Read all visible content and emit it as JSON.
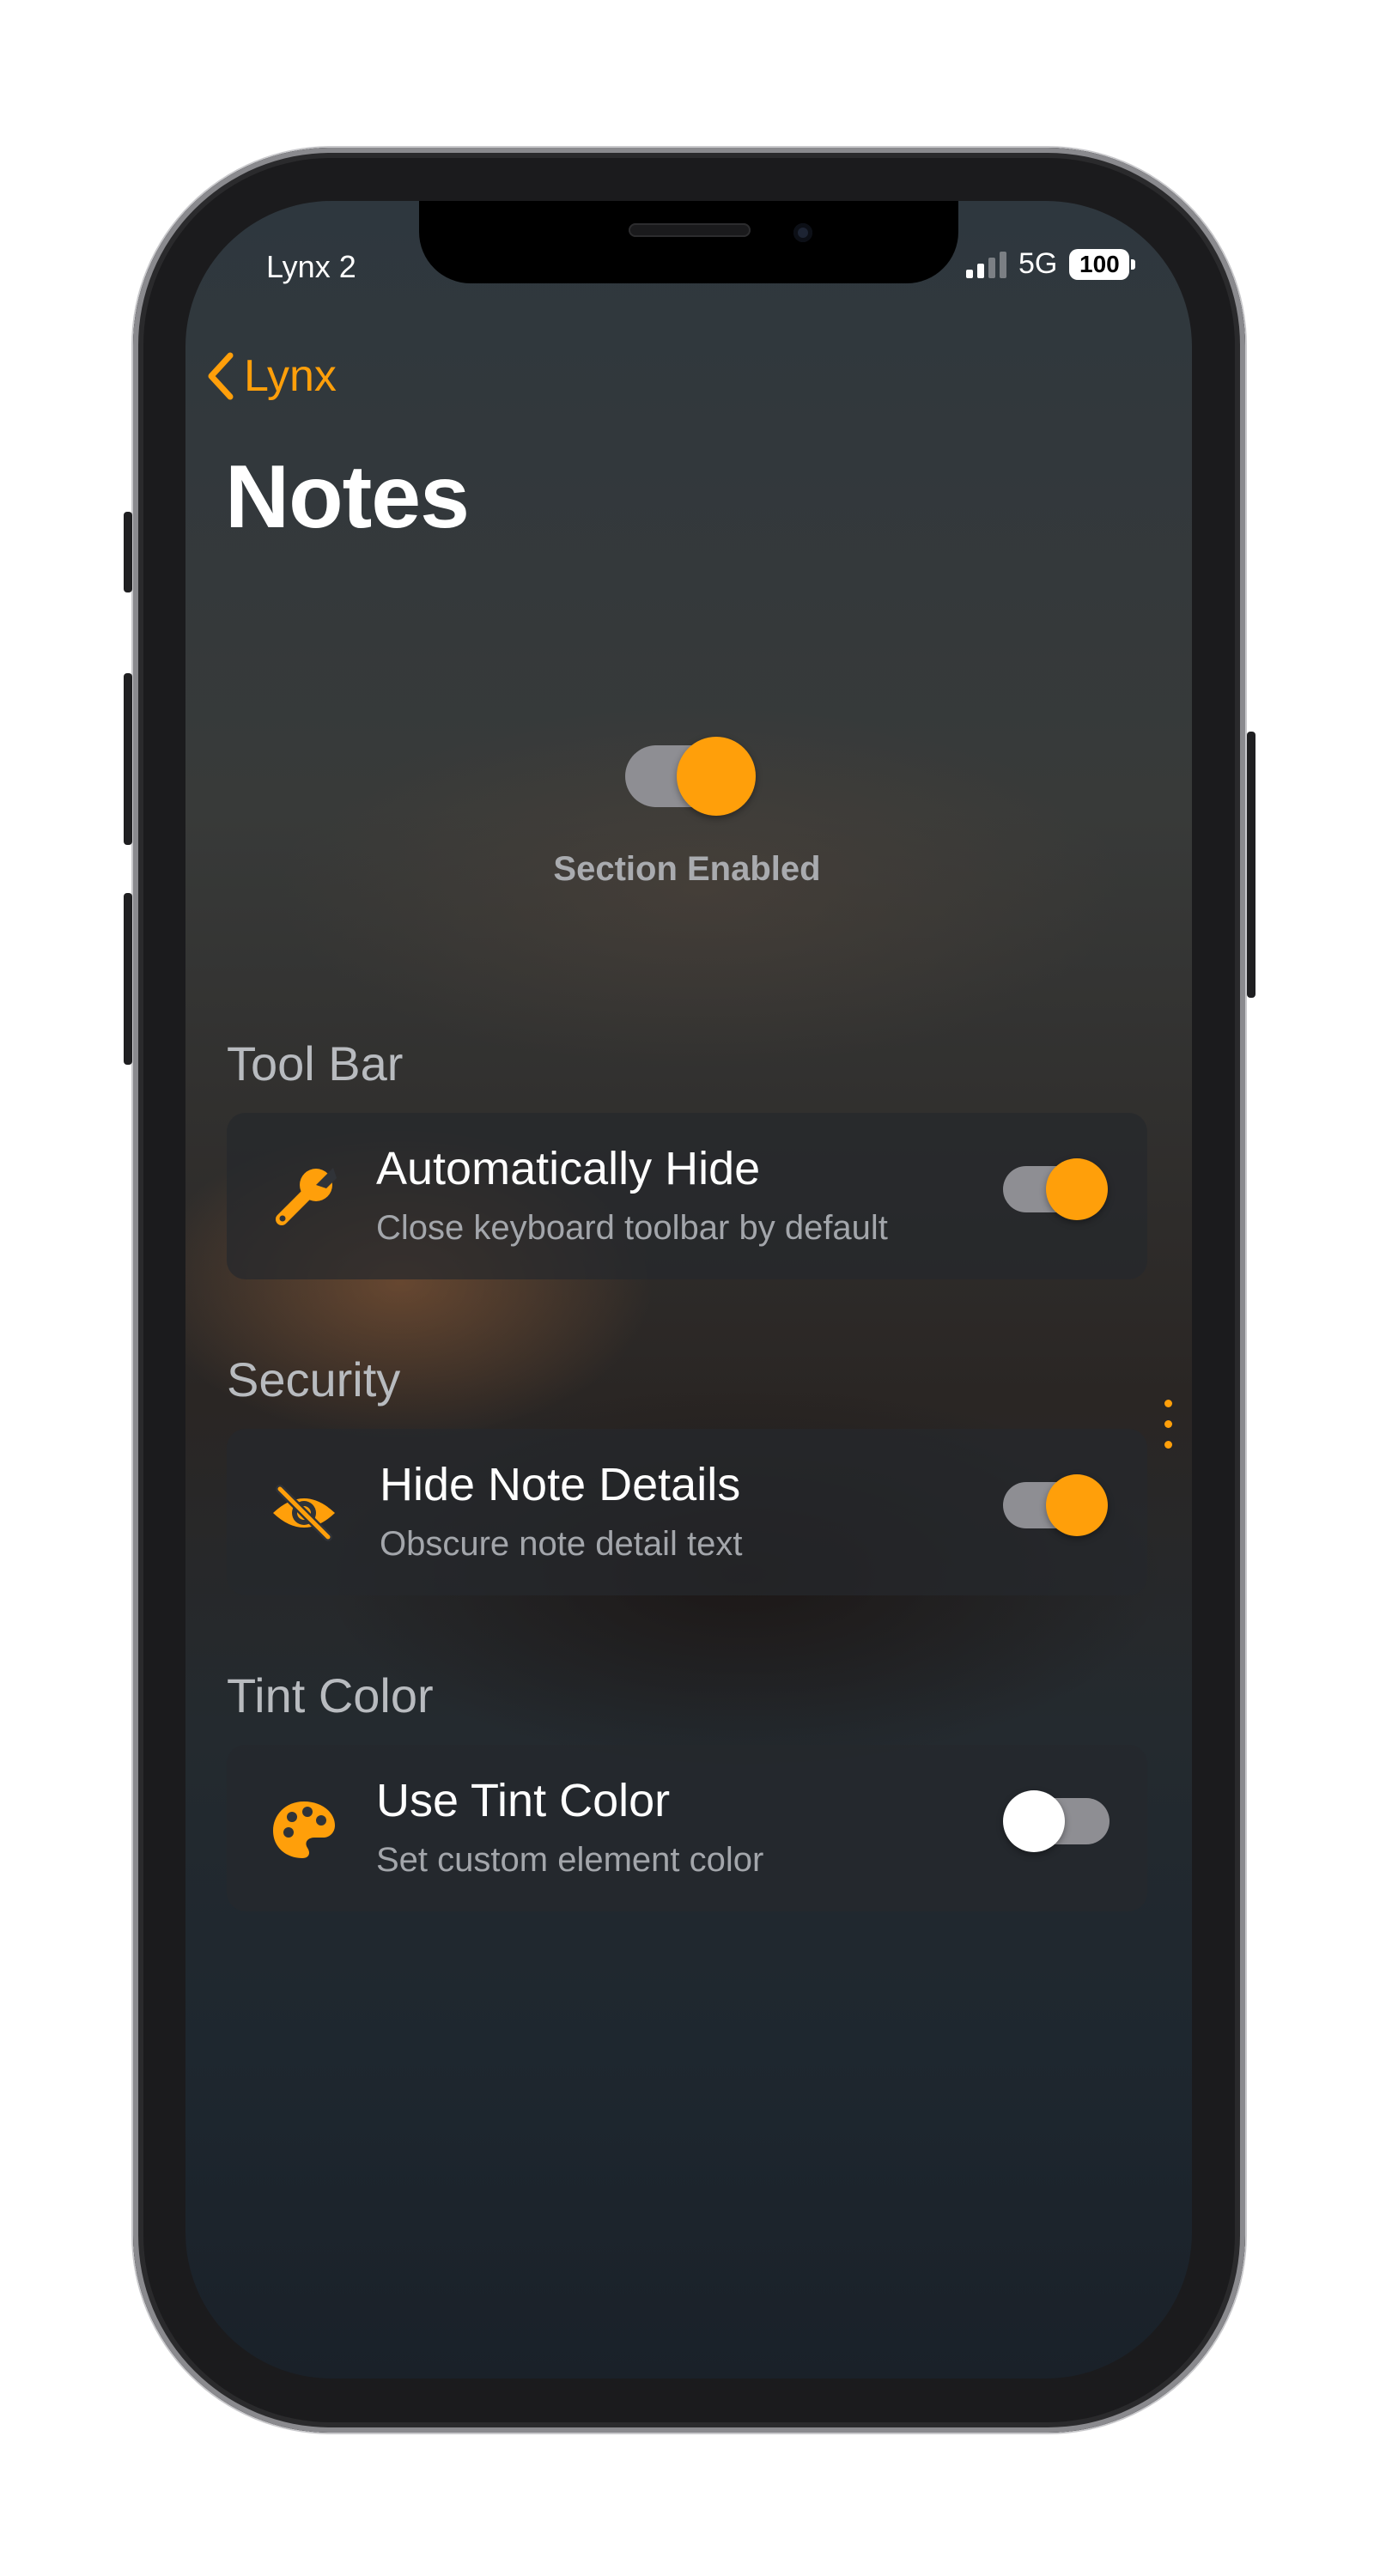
{
  "colors": {
    "accent": "#ff9f0a",
    "toggle_track_off": "#8e8e93"
  },
  "status_bar": {
    "carrier": "Lynx 2",
    "network": "5G",
    "battery": "100"
  },
  "nav": {
    "back_label": "Lynx",
    "title": "Notes"
  },
  "master": {
    "label": "Section Enabled",
    "enabled": true
  },
  "sections": [
    {
      "header": "Tool Bar",
      "title": "Automatically Hide",
      "subtitle": "Close keyboard toolbar by default",
      "icon": "wrench-icon",
      "enabled": true
    },
    {
      "header": "Security",
      "title": "Hide Note Details",
      "subtitle": "Obscure note detail text",
      "icon": "eye-slash-icon",
      "enabled": true
    },
    {
      "header": "Tint Color",
      "title": "Use Tint Color",
      "subtitle": "Set custom element color",
      "icon": "palette-icon",
      "enabled": false
    }
  ]
}
